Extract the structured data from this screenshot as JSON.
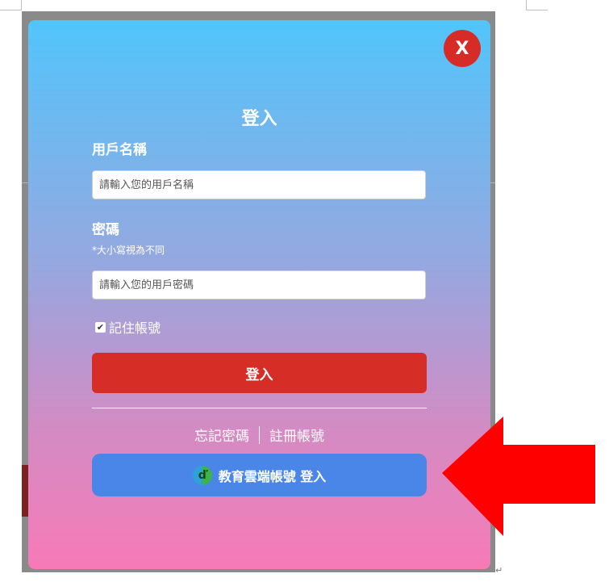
{
  "modal": {
    "close_label": "X",
    "title": "登入",
    "username_label": "用戶名稱",
    "username_placeholder": "請輸入您的用戶名稱",
    "password_label": "密碼",
    "password_hint": "*大小寫視為不同",
    "password_placeholder": "請輸入您的用戶密碼",
    "remember_label": "記住帳號",
    "remember_checked": true,
    "login_button": "登入",
    "forgot_password": "忘記密碼",
    "register": "註冊帳號",
    "edu_login": "教育雲端帳號 登入"
  },
  "colors": {
    "close_button": "#d72b27",
    "login_button": "#d62d27",
    "edu_button": "#4a86e8",
    "arrow": "#ff0000",
    "gradient_top": "#51c5fb",
    "gradient_bottom": "#f77ab7"
  },
  "icons": {
    "close": "close-icon",
    "checkbox": "checkmark-icon",
    "edu": "edu-cloud-logo-icon",
    "annotation": "arrow-left-icon"
  }
}
